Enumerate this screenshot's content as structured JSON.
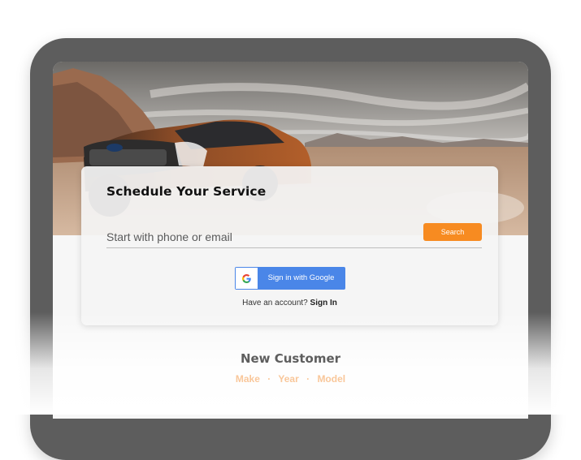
{
  "schedule": {
    "title": "Schedule Your Service",
    "search_placeholder": "Start with phone or email",
    "search_button": "Search",
    "google_button": "Sign in with Google",
    "account_prompt": "Have an account?",
    "signin_link": "Sign In"
  },
  "new_customer": {
    "title": "New Customer",
    "items": [
      "Make",
      "Year",
      "Model"
    ],
    "separator": "·"
  },
  "colors": {
    "accent_orange": "#f78b21",
    "google_blue": "#4a86e8",
    "device_frame": "#5d5d5d"
  },
  "icons": {
    "google": "google-g-icon"
  }
}
